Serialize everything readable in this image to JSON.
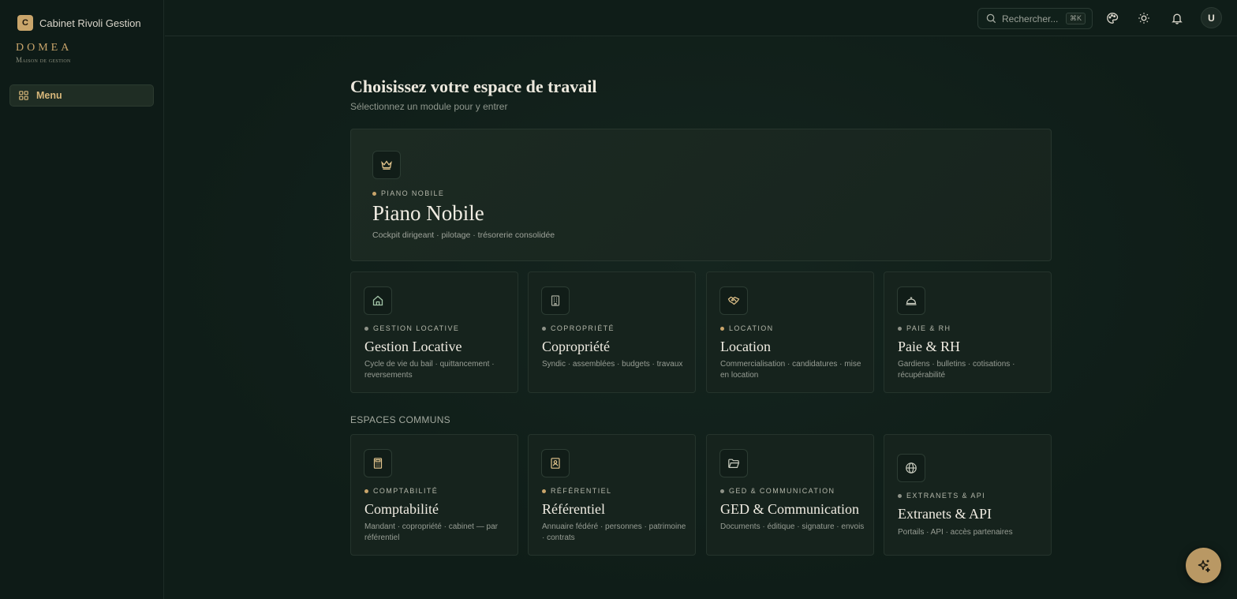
{
  "sidebar": {
    "org_initial": "C",
    "org_name": "Cabinet Rivoli Gestion",
    "brand_title": "DOMEA",
    "brand_subtitle": "Maison de gestion",
    "menu_label": "Menu"
  },
  "topbar": {
    "search_placeholder": "Rechercher...",
    "search_shortcut": "⌘K",
    "avatar_initial": "U",
    "icons": [
      "palette-icon",
      "sun-icon",
      "bell-icon"
    ]
  },
  "main": {
    "title": "Choisissez votre espace de travail",
    "subtitle": "Sélectionnez un module pour y entrer",
    "hero": {
      "tag": "PIANO NOBILE",
      "title": "Piano Nobile",
      "description": "Cockpit dirigeant · pilotage · trésorerie consolidée",
      "icon": "crown-icon"
    },
    "modules": [
      {
        "tag": "GESTION LOCATIVE",
        "title": "Gestion Locative",
        "description": "Cycle de vie du bail · quittancement · reversements",
        "icon": "home-icon",
        "dot_color": "#8e9288"
      },
      {
        "tag": "COPROPRIÉTÉ",
        "title": "Copropriété",
        "description": "Syndic · assemblées · budgets · travaux",
        "icon": "building-icon",
        "dot_color": "#8e9288"
      },
      {
        "tag": "LOCATION",
        "title": "Location",
        "description": "Commercialisation · candidatures · mise en location",
        "icon": "handshake-icon",
        "dot_color": "#c9a56b"
      },
      {
        "tag": "PAIE & RH",
        "title": "Paie & RH",
        "description": "Gardiens · bulletins · cotisations · récupérabilité",
        "icon": "concierge-bell-icon",
        "dot_color": "#8e9288"
      }
    ],
    "section_label": "ESPACES COMMUNS",
    "common": [
      {
        "tag": "COMPTABILITÉ",
        "title": "Comptabilité",
        "description": "Mandant · copropriété · cabinet — par référentiel",
        "icon": "calculator-icon",
        "dot_color": "#c9a56b"
      },
      {
        "tag": "RÉFÉRENTIEL",
        "title": "Référentiel",
        "description": "Annuaire fédéré · personnes · patrimoine · contrats",
        "icon": "contact-book-icon",
        "dot_color": "#c9a56b"
      },
      {
        "tag": "GED & COMMUNICATION",
        "title": "GED & Communication",
        "description": "Documents · éditique · signature · envois",
        "icon": "folder-icon",
        "dot_color": "#8e9288"
      },
      {
        "tag": "EXTRANETS & API",
        "title": "Extranets & API",
        "description": "Portails · API · accès partenaires",
        "icon": "globe-icon",
        "dot_color": "#8e9288"
      }
    ]
  },
  "colors": {
    "accent": "#c9a56b",
    "background": "#0f1d18"
  },
  "fab_icon": "sparkles-icon"
}
